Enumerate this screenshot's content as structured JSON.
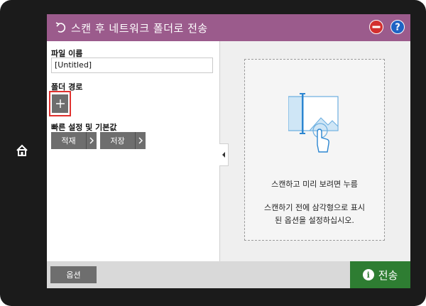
{
  "header": {
    "title": "스캔 후 네트워크 폴더로 전송"
  },
  "form": {
    "file_name_label": "파일 이름",
    "file_name_value": "[Untitled]",
    "folder_path_label": "폴더 경로",
    "quick_sets_label": "빠른 설정 및 기본값",
    "load_label": "적재",
    "save_label": "저장"
  },
  "preview": {
    "line1": "스캔하고 미리 보려면 누름",
    "line2": "스캔하기 전에 삼각형으로 표시",
    "line3": "된 옵션을 설정하십시오."
  },
  "footer": {
    "options_label": "옵션",
    "send_label": "전송"
  },
  "colors": {
    "title_bar": "#9b5b8c",
    "send_button": "#2e7d32",
    "highlight": "#e0312e",
    "button_gray": "#6e6e6e"
  },
  "icons": [
    "back-icon",
    "stop-icon",
    "help-icon",
    "home-icon",
    "plus-icon",
    "chevron-right-icon",
    "chevron-left-icon",
    "scan-preview-icon",
    "info-icon"
  ]
}
